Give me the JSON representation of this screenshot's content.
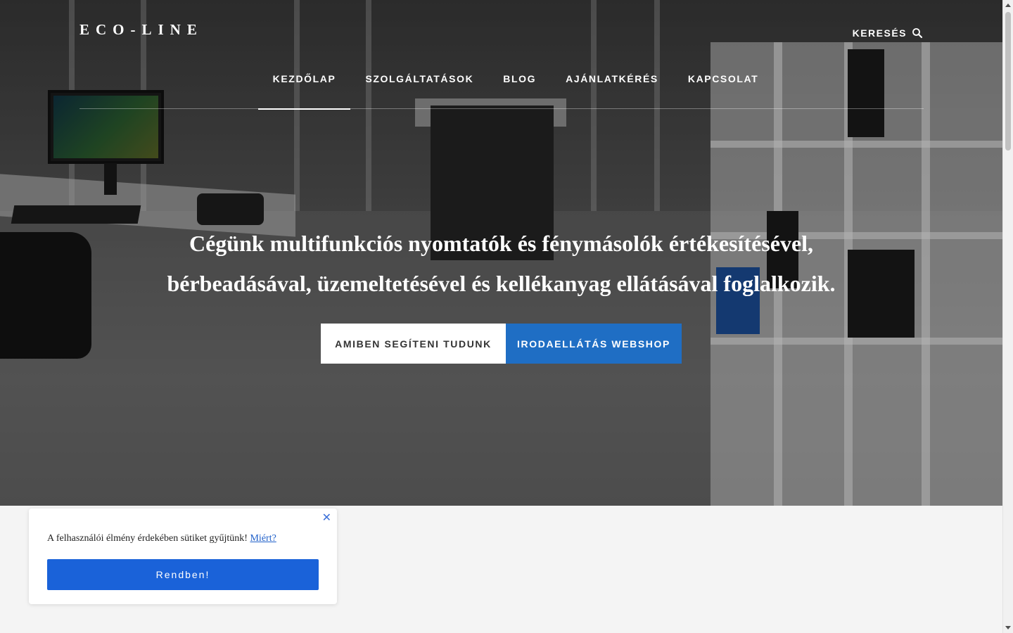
{
  "header": {
    "logo": "ECO-LINE",
    "search_label": "KERESÉS",
    "search_icon": "search-icon"
  },
  "nav": {
    "items": [
      {
        "label": "KEZDŐLAP",
        "active": true
      },
      {
        "label": "SZOLGÁLTATÁSOK",
        "active": false
      },
      {
        "label": "BLOG",
        "active": false
      },
      {
        "label": "AJÁNLATKÉRÉS",
        "active": false
      },
      {
        "label": "KAPCSOLAT",
        "active": false
      }
    ]
  },
  "hero": {
    "headline_line1": "Cégünk multifunkciós nyomtatók és fénymásolók értékesítésével,",
    "headline_line2": "bérbeadásával, üzemeltetésével és kellékanyag ellátásával foglalkozik.",
    "button_primary": "AMIBEN SEGÍTENI TUDUNK",
    "button_secondary": "IRODAELLÁTÁS WEBSHOP"
  },
  "cookie": {
    "text": "A felhasználói élmény érdekében sütiket gyűjtünk!",
    "link": "Miért?",
    "button": "Rendben!",
    "close_icon": "close-icon"
  },
  "colors": {
    "accent_blue": "#1f6ec4",
    "cookie_button": "#1a62d9",
    "page_bg": "#f4f4f4"
  }
}
